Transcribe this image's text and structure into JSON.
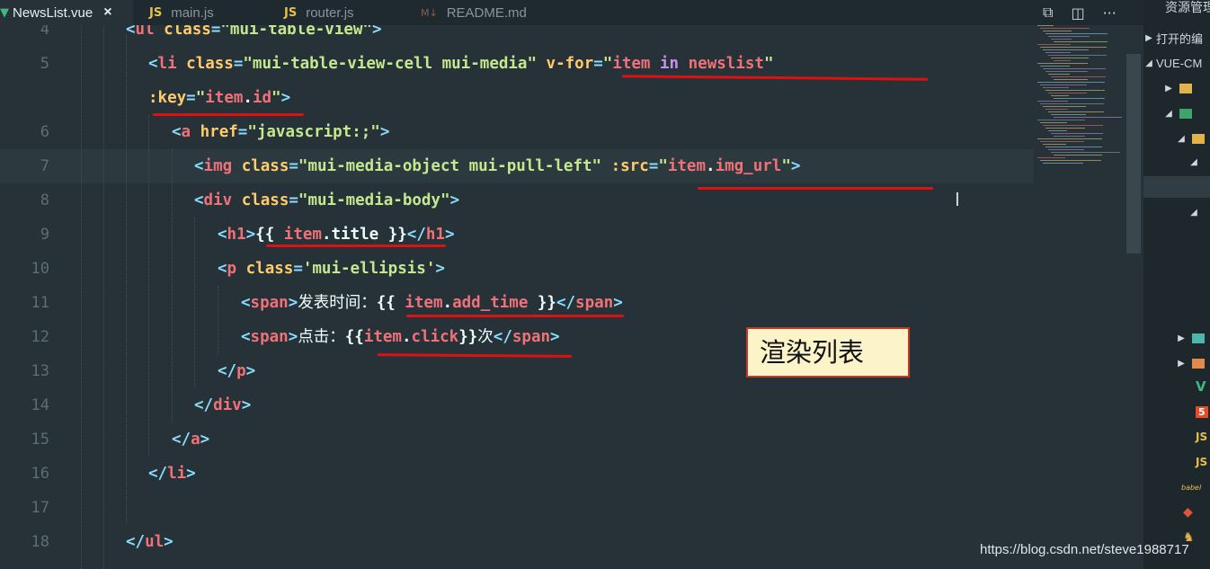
{
  "tabs": [
    {
      "label": "NewsList.vue",
      "icon": "vue-icon",
      "active": true,
      "close": "×"
    },
    {
      "label": "main.js",
      "badge": "JS"
    },
    {
      "label": "router.js",
      "badge": "JS"
    },
    {
      "label": "README.md",
      "badge": "M↓"
    }
  ],
  "tab_actions": [
    "open-preview-icon",
    "split-editor-icon",
    "more-actions-icon"
  ],
  "tab_actions_glyphs": {
    "preview": "⧉",
    "split": "◫",
    "more": "···"
  },
  "line_numbers": [
    "4",
    "5",
    "",
    "6",
    "7",
    "8",
    "9",
    "10",
    "11",
    "12",
    "13",
    "14",
    "15",
    "16",
    "17",
    "18"
  ],
  "code": {
    "l4": {
      "open": "<",
      "tag": "ul",
      "attr": " class",
      "eq": "=",
      "val": "\"mui-table-view\"",
      "close": ">"
    },
    "l5": {
      "open": "<",
      "tag": "li",
      "attr": " class",
      "eq": "=",
      "val": "\"mui-table-view-cell mui-media\"",
      "attr2": " v-for",
      "eq2": "=",
      "q1": "\"",
      "item": "item",
      "in": " in ",
      "list": "newslist",
      "q2": "\""
    },
    "l5b": {
      "attr": ":key",
      "eq": "=",
      "q1": "\"",
      "item": "item",
      "dot": ".",
      "prop": "id",
      "q2": "\"",
      "close": ">"
    },
    "l6": {
      "open": "<",
      "tag": "a",
      "attr": " href",
      "eq": "=",
      "val": "\"javascript:;\"",
      "close": ">"
    },
    "l7": {
      "open": "<",
      "tag": "img",
      "attr": " class",
      "eq": "=",
      "val": "\"mui-media-object mui-pull-left\"",
      "attr2": " :src",
      "eq2": "=",
      "q1": "\"",
      "item": "item",
      "dot": ".",
      "prop": "img_url",
      "q2": "\"",
      "close": ">"
    },
    "l8": {
      "open": "<",
      "tag": "div",
      "attr": " class",
      "eq": "=",
      "val": "\"mui-media-body\"",
      "close": ">"
    },
    "l9": {
      "open": "<",
      "tag": "h1",
      "close": ">",
      "mo": "{{ ",
      "item": "item",
      "dot": ".",
      "prop": "title",
      "mc": " }}",
      "eopen": "</",
      "etag": "h1",
      "eclose": ">"
    },
    "l10": {
      "open": "<",
      "tag": "p",
      "attr": " class",
      "eq": "=",
      "val": "'mui-ellipsis'",
      "close": ">"
    },
    "l11": {
      "open": "<",
      "tag": "span",
      "close": ">",
      "text": "发表时间：",
      "mo": "{{ ",
      "item": "item",
      "dot": ".",
      "prop": "add_time",
      "mc": " }}",
      "eopen": "</",
      "etag": "span",
      "eclose": ">"
    },
    "l12": {
      "open": "<",
      "tag": "span",
      "close": ">",
      "text": "点击：",
      "mo": "{{",
      "item": "item",
      "dot": ".",
      "prop": "click",
      "mc": "}}",
      "text2": "次",
      "eopen": "</",
      "etag": "span",
      "eclose": ">"
    },
    "l13": {
      "open": "</",
      "tag": "p",
      "close": ">"
    },
    "l14": {
      "open": "</",
      "tag": "div",
      "close": ">"
    },
    "l15": {
      "open": "</",
      "tag": "a",
      "close": ">"
    },
    "l16": {
      "open": "</",
      "tag": "li",
      "close": ">"
    },
    "l18": {
      "open": "</",
      "tag": "ul",
      "close": ">"
    }
  },
  "annotation": "渲染列表",
  "sidebar": {
    "title": "资源管理",
    "open_editors": "打开的编",
    "project": "VUE-CM",
    "icons": [
      "folder-icon",
      "folder-icon",
      "folder-icon",
      "image-folder-icon",
      "folder-icon",
      "vue-file-icon",
      "html-file-icon",
      "js-file-icon",
      "js-file-icon",
      "babel-file-icon",
      "git-file-icon",
      "package-file-icon"
    ],
    "glyphs": {
      "expand": "▶",
      "collapse": "◢",
      "vue": "V",
      "html": "5",
      "js": "JS",
      "babel": "babel",
      "git": "◆",
      "package": "♞"
    }
  },
  "watermark": "https://blog.csdn.net/steve1988717",
  "colors": {
    "tag": "#f07178",
    "attr": "#ffcb6b",
    "string": "#c3e88d",
    "punct": "#89ddff",
    "keyword": "#c792ea",
    "underline": "#dd1111"
  }
}
